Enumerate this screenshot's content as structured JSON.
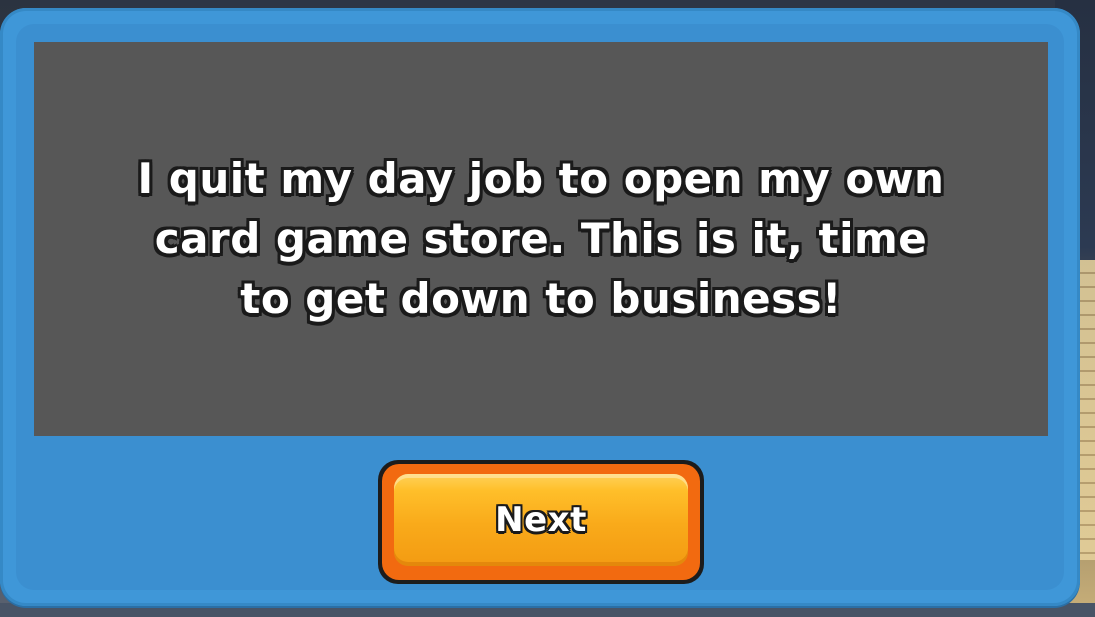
{
  "dialog": {
    "message": "I quit my day job to open my own card game store. This is it, time to get down to business!",
    "next_button_label": "Next"
  },
  "colors": {
    "frame": "#3f97d8",
    "panel": "#575757",
    "button_face": "#f9aa1a",
    "button_rim": "#f26a10",
    "text": "#ffffff",
    "outline": "#1a1a1a"
  }
}
